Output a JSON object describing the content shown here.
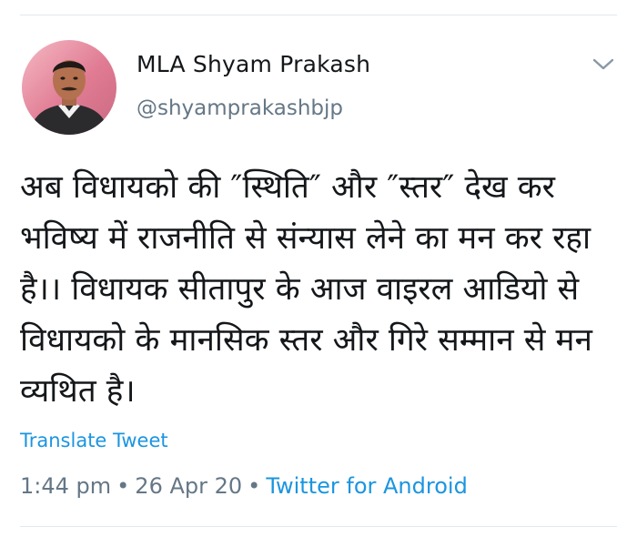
{
  "author": {
    "name": "MLA Shyam Prakash",
    "handle": "@shyamprakashbjp"
  },
  "tweet": {
    "text": "अब विधायको की ″स्थिति″ और ″स्तर″ देख कर भविष्य में  राजनीति से संन्यास लेने का मन कर रहा है।। विधायक सीतापुर के आज वाइरल आडियो से विधायको के मानसिक स्तर और गिरे सम्मान से मन व्यथित है।",
    "translate_label": "Translate Tweet",
    "time": "1:44 pm",
    "date": "26 Apr 20",
    "separator": "•",
    "source": "Twitter for Android"
  },
  "icons": {
    "menu": "chevron-down-icon",
    "avatar": "avatar"
  },
  "colors": {
    "link": "#1b95e0",
    "secondary_text": "#657786",
    "primary_text": "#14171a",
    "divider": "#e1e8ed"
  }
}
